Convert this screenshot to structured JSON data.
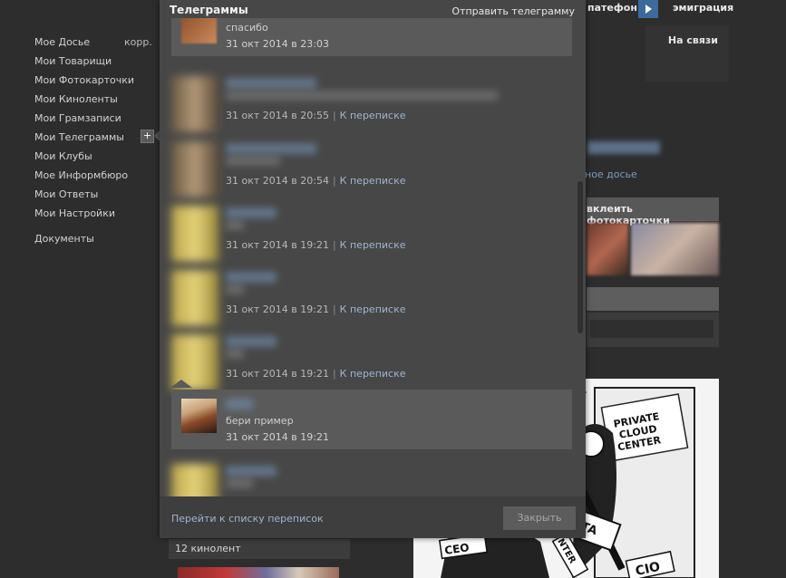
{
  "sidebar": {
    "items": [
      {
        "label": "Мое Досье",
        "badge": "корр."
      },
      {
        "label": "Мои Товарищи"
      },
      {
        "label": "Мои Фотокарточки"
      },
      {
        "label": "Мои Киноленты"
      },
      {
        "label": "Мои Грамзаписи"
      },
      {
        "label": "Мои Телеграммы"
      },
      {
        "label": "Мои Клубы"
      },
      {
        "label": "Мое Информбюро"
      },
      {
        "label": "Мои Ответы"
      },
      {
        "label": "Мои Настройки"
      },
      {
        "label": "Документы"
      }
    ],
    "plus_label": "+"
  },
  "topbar": {
    "link1": "патефон",
    "link2": "эмиграция"
  },
  "background": {
    "online": "На связи",
    "dossier_link": "ное досье",
    "photos_button": "вклеить фотокарточки",
    "movies_count": "12 кинолент"
  },
  "popup": {
    "title": "Телеграммы",
    "send_link": "Отправить телеграмму",
    "list_link": "Перейти к списку переписок",
    "close_label": "Закрыть",
    "thread_link": "К переписке",
    "messages": [
      {
        "preview": "спасибо",
        "time": "31 окт 2014 в 23:03"
      },
      {
        "preview": "",
        "time": "31 окт 2014 в 20:55"
      },
      {
        "preview": "",
        "time": "31 окт 2014 в 20:54"
      },
      {
        "preview": "",
        "time": "31 окт 2014 в 19:21"
      },
      {
        "preview": "",
        "time": "31 окт 2014 в 19:21"
      },
      {
        "preview": "",
        "time": "31 окт 2014 в 19:21"
      },
      {
        "preview": "бери пример",
        "time": "31 окт 2014 в 19:21"
      }
    ]
  }
}
